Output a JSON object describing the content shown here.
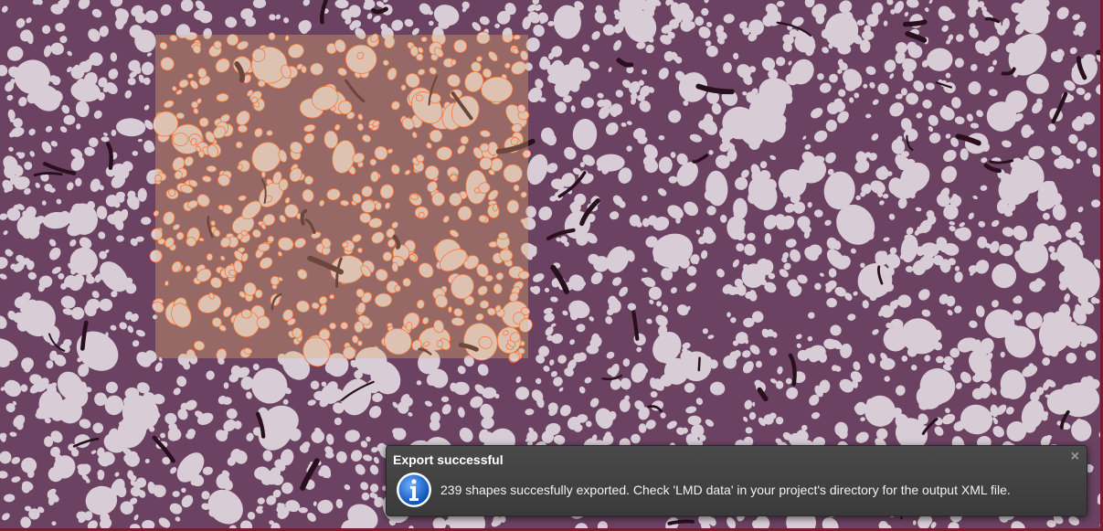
{
  "viewer": {
    "image_colors": {
      "tissue": "#6b4262",
      "alveoli": "#d8cdd6",
      "vessel": "#2a0f1f",
      "selection_tint": "#e8b070",
      "selection_outline": "#ff5a1a",
      "border": "#7a1c2c"
    }
  },
  "notification": {
    "title": "Export successful",
    "close_label": "×",
    "icon": "info-icon",
    "message": "239 shapes succesfully exported. Check 'LMD data' in your project's directory for the output XML file."
  }
}
